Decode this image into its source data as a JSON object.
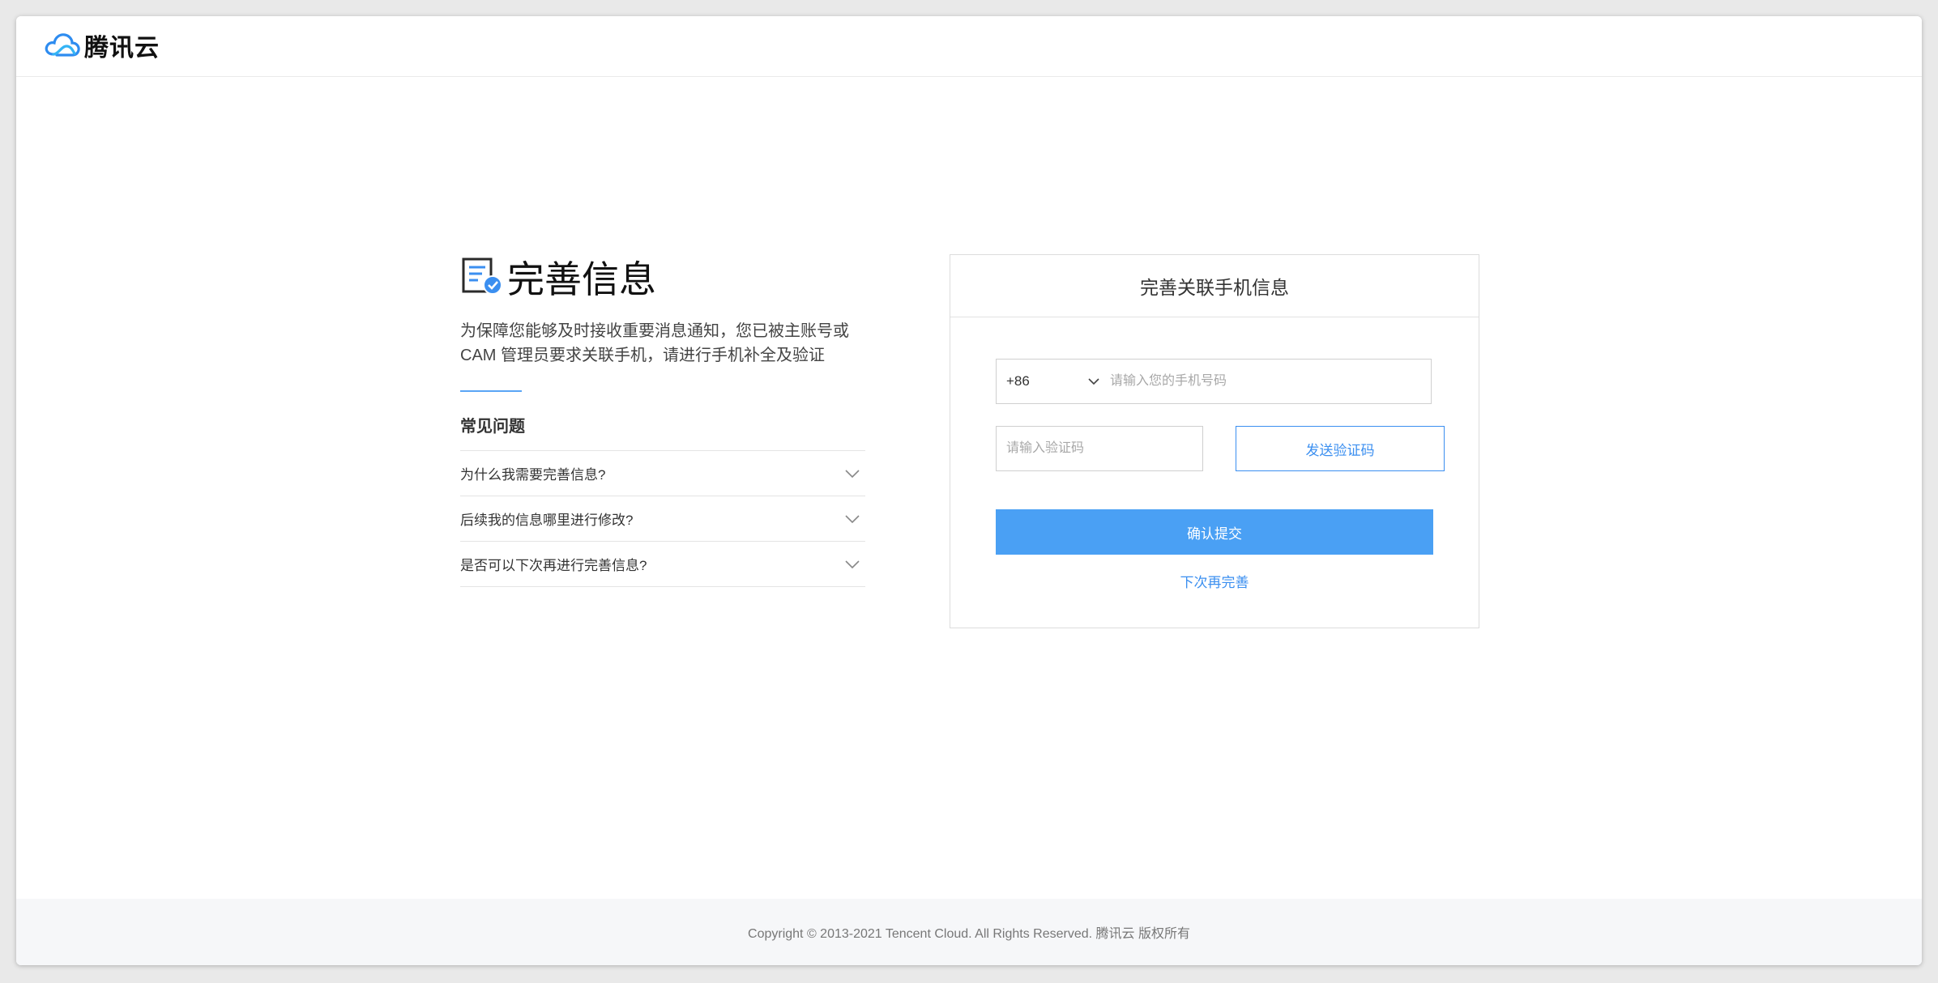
{
  "header": {
    "brand": "腾讯云",
    "logo_icon": "tencent-cloud-logo-icon"
  },
  "info": {
    "title": "完善信息",
    "title_icon": "document-check-icon",
    "description_line1": "为保障您能够及时接收重要消息通知，您已被主账号或",
    "description_line2": "CAM 管理员要求关联手机，请进行手机补全及验证",
    "faq_title": "常见问题",
    "faq_items": [
      {
        "label": "为什么我需要完善信息?"
      },
      {
        "label": "后续我的信息哪里进行修改?"
      },
      {
        "label": "是否可以下次再进行完善信息?"
      }
    ]
  },
  "form": {
    "title": "完善关联手机信息",
    "country_code": "+86",
    "phone_placeholder": "请输入您的手机号码",
    "phone_value": "",
    "code_placeholder": "请输入验证码",
    "code_value": "",
    "send_code_label": "发送验证码",
    "submit_label": "确认提交",
    "later_label": "下次再完善"
  },
  "footer": {
    "copyright": "Copyright © 2013-2021 Tencent Cloud. All Rights Reserved. 腾讯云 版权所有"
  },
  "colors": {
    "accent": "#4aa0f4",
    "link": "#3b8ff0",
    "divider_accent": "#5aa5f5",
    "footer_bg": "#f6f7f9"
  }
}
